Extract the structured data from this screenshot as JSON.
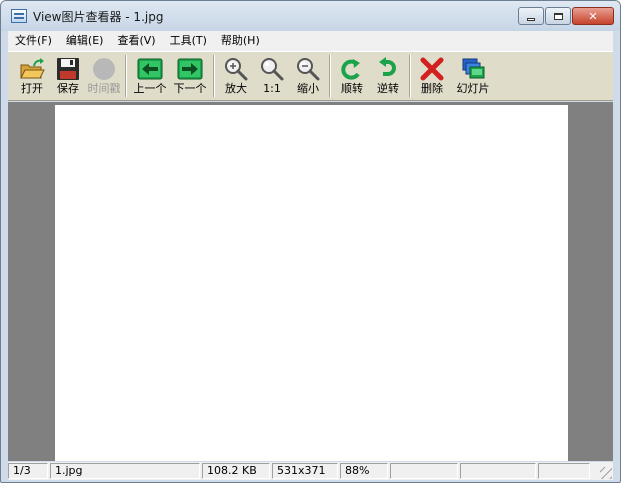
{
  "window": {
    "title": "View图片查看器 - 1.jpg"
  },
  "menu": {
    "items": [
      {
        "label": "文件(F)"
      },
      {
        "label": "编辑(E)"
      },
      {
        "label": "查看(V)"
      },
      {
        "label": "工具(T)"
      },
      {
        "label": "帮助(H)"
      }
    ]
  },
  "toolbar": {
    "open": "打开",
    "save": "保存",
    "timer": "时间戳",
    "prev": "上一个",
    "next": "下一个",
    "zoom_in": "放大",
    "actual_size": "1:1",
    "zoom_out": "缩小",
    "rotate_cw": "顺转",
    "rotate_ccw": "逆转",
    "delete": "删除",
    "slideshow": "幻灯片"
  },
  "status": {
    "index": "1/3",
    "filename": "1.jpg",
    "filesize": "108.2 KB",
    "dimensions": "531x371",
    "zoom": "88%"
  },
  "colors": {
    "toolbar_bg": "#dfdcc9",
    "viewer_bg": "#808080",
    "arrow_green": "#1aa34a",
    "delete_red": "#d21f1f",
    "close_red": "#c7432c"
  }
}
